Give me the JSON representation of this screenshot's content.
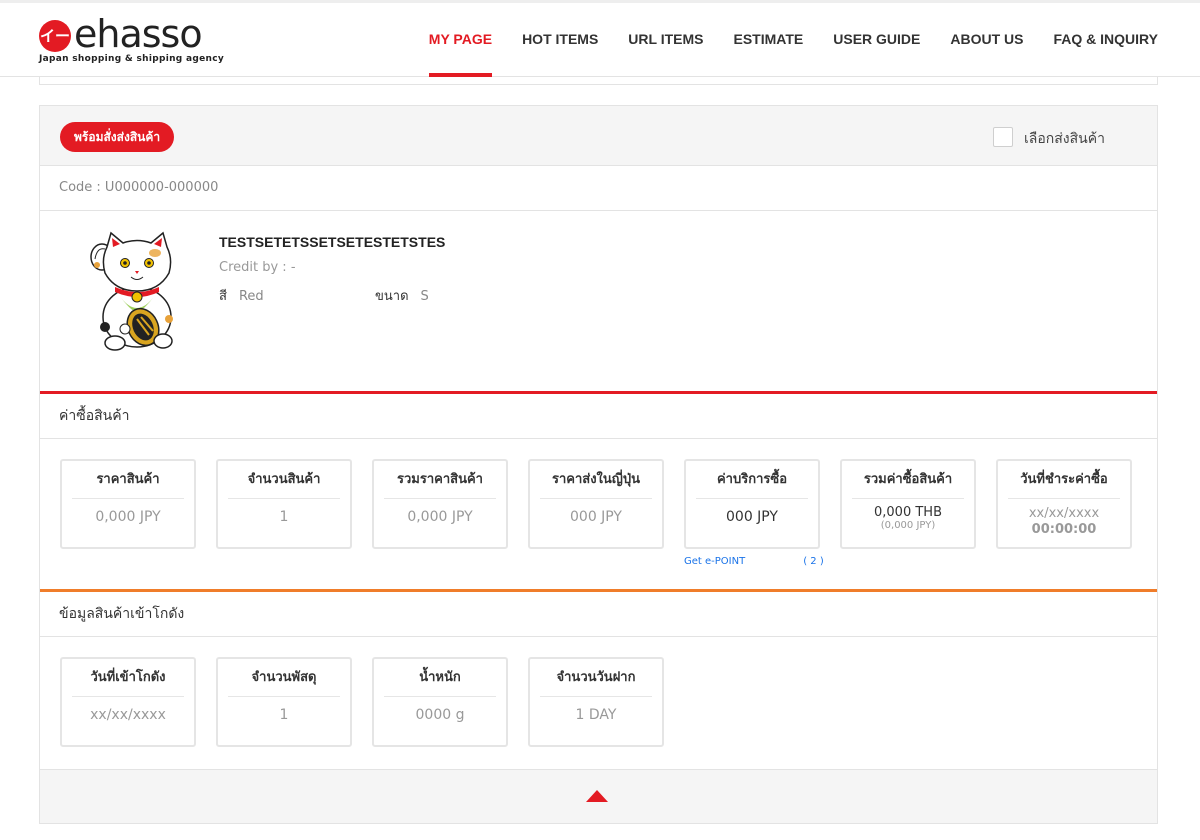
{
  "brand": {
    "logo_glyph": "イー",
    "name": "ehasso",
    "tagline": "Japan shopping & shipping agency",
    "accent": "#e31b23"
  },
  "nav": [
    {
      "label": "MY PAGE",
      "active": true
    },
    {
      "label": "HOT ITEMS",
      "active": false
    },
    {
      "label": "URL ITEMS",
      "active": false
    },
    {
      "label": "ESTIMATE",
      "active": false
    },
    {
      "label": "USER GUIDE",
      "active": false
    },
    {
      "label": "ABOUT US",
      "active": false
    },
    {
      "label": "FAQ & INQUIRY",
      "active": false
    }
  ],
  "order": {
    "status_label": "พร้อมสั่งส่งสินค้า",
    "select_label": "เลือกส่งสินค้า",
    "select_checked": false,
    "code": "Code : U000000-000000",
    "product": {
      "image_icon": "maneki-neko-image",
      "name": "TESTSETETSSETSETESTETSTES",
      "credit": "Credit by : -",
      "color_label": "สี",
      "color_value": "Red",
      "size_label": "ขนาด",
      "size_value": "S"
    },
    "purchase": {
      "title": "ค่าซื้อสินค้า",
      "boxes": [
        {
          "title": "ราคาสินค้า",
          "value": "0,000 JPY"
        },
        {
          "title": "จำนวนสินค้า",
          "value": "1"
        },
        {
          "title": "รวมราคาสินค้า",
          "value": "0,000 JPY"
        },
        {
          "title": "ราคาส่งในญี่ปุ่น",
          "value": "000 JPY"
        },
        {
          "title": "ค่าบริการซื้อ",
          "value": "000 JPY"
        },
        {
          "title": "รวมค่าซื้อสินค้า",
          "value": "0,000 THB",
          "sub": "(0,000 JPY)"
        },
        {
          "title": "วันที่ชำระค่าซื้อ",
          "value": "xx/xx/xxxx",
          "sub": "00:00:00"
        }
      ],
      "epoint_label": "Get e-POINT",
      "epoint_value": "( 2 )"
    },
    "warehouse": {
      "title": "ข้อมูลสินค้าเข้าโกดัง",
      "boxes": [
        {
          "title": "วันที่เข้าโกดัง",
          "value": "xx/xx/xxxx"
        },
        {
          "title": "จำนวนพัสดุ",
          "value": "1"
        },
        {
          "title": "น้ำหนัก",
          "value": "0000 g"
        },
        {
          "title": "จำนวนวันฝาก",
          "value": "1 DAY"
        }
      ]
    },
    "collapse_icon": "caret-up-icon"
  }
}
